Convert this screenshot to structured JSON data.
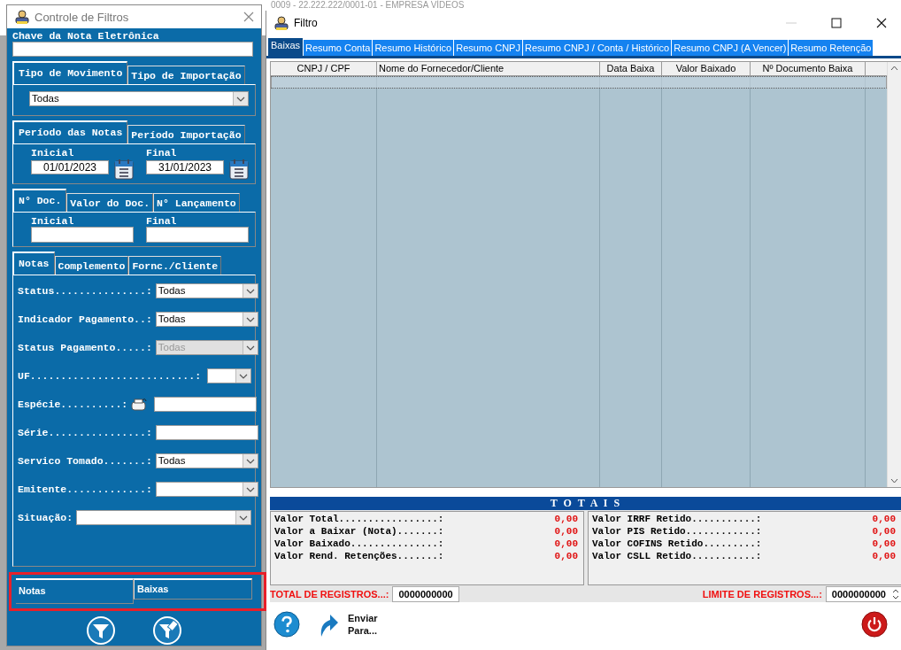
{
  "background_title": "0009 - 22.222.222/0001-01 - EMPRESA VÍDEOS",
  "filter_window": {
    "title": "Controle de Filtros",
    "key_field": {
      "label": "Chave da Nota Eletrônica"
    },
    "movement": {
      "tabs": [
        {
          "label": "Tipo de Movimento",
          "selected": true
        },
        {
          "label": "Tipo de Importação",
          "selected": false
        }
      ],
      "value": "Todas"
    },
    "period": {
      "tabs": [
        {
          "label": "Período das Notas",
          "selected": true
        },
        {
          "label": "Período Importação",
          "selected": false
        }
      ],
      "fields": [
        {
          "label": "Inicial",
          "value": "01/01/2023"
        },
        {
          "label": "Final",
          "value": "31/01/2023"
        }
      ]
    },
    "document": {
      "tabs": [
        {
          "label": "N° Doc.",
          "selected": true
        },
        {
          "label": "Valor do Doc.",
          "selected": false
        },
        {
          "label": "N° Lançamento",
          "selected": false
        }
      ],
      "fields": [
        {
          "label": "Inicial"
        },
        {
          "label": "Final"
        }
      ]
    },
    "details": {
      "tabs": [
        {
          "label": "Notas",
          "selected": true
        },
        {
          "label": "Complemento",
          "selected": false
        },
        {
          "label": "Fornc./Cliente",
          "selected": false
        }
      ],
      "rows": [
        {
          "label": "Status...............:",
          "kind": "select",
          "value": "Todas",
          "disabled": false
        },
        {
          "label": "Indicador Pagamento..:",
          "kind": "select",
          "value": "Todas",
          "disabled": false
        },
        {
          "label": "Status Pagamento.....:",
          "kind": "select",
          "value": "Todas",
          "disabled": true
        },
        {
          "label": "UF...........................:",
          "kind": "narrow-select",
          "disabled": false
        },
        {
          "label": "Espécie..........:",
          "kind": "lookup",
          "disabled": false
        },
        {
          "label": "Série................:",
          "kind": "text",
          "disabled": false
        },
        {
          "label": "Servico Tomado.......:",
          "kind": "select",
          "value": "Todas",
          "disabled": false
        },
        {
          "label": "Emitente.............:",
          "kind": "select",
          "disabled": false
        },
        {
          "label": "Situação:",
          "kind": "wide-select",
          "disabled": false
        }
      ]
    },
    "bottom_tabs": {
      "highlighted": true,
      "tabs": [
        {
          "label": "Notas",
          "selected": true
        },
        {
          "label": "Baixas",
          "selected": false
        }
      ]
    }
  },
  "results_window": {
    "title": "Filtro",
    "tabs": [
      {
        "label": "Baixas",
        "selected": true
      },
      {
        "label": "Resumo Conta",
        "selected": false
      },
      {
        "label": "Resumo Histórico",
        "selected": false
      },
      {
        "label": "Resumo CNPJ",
        "selected": false
      },
      {
        "label": "Resumo CNPJ / Conta / Histórico",
        "selected": false
      },
      {
        "label": "Resumo CNPJ (A Vencer)",
        "selected": false
      },
      {
        "label": "Resumo Retenção",
        "selected": false
      }
    ],
    "table": {
      "columns": [
        "CNPJ / CPF",
        "Nome do Fornecedor/Cliente",
        "Data Baixa",
        "Valor Baixado",
        "Nº Documento Baixa"
      ],
      "rows": [
        {
          "selected": true
        }
      ]
    },
    "totals": {
      "title": "T O T A I S",
      "left": [
        {
          "label": "Valor Total.................:",
          "value": "0,00"
        },
        {
          "label": "Valor a Baixar (Nota).......:",
          "value": "0,00"
        },
        {
          "label": "Valor Baixado...............:",
          "value": "0,00"
        },
        {
          "label": "Valor Rend. Retenções.......:",
          "value": "0,00"
        }
      ],
      "right": [
        {
          "label": "Valor IRRF Retido...........:",
          "value": "0,00"
        },
        {
          "label": "Valor PIS Retido............:",
          "value": "0,00"
        },
        {
          "label": "Valor COFINS Retido.........:",
          "value": "0,00"
        },
        {
          "label": "Valor CSLL Retido...........:",
          "value": "0,00"
        }
      ]
    },
    "record_count": {
      "label": "TOTAL DE REGISTROS...:",
      "value": "0000000000"
    },
    "record_limit": {
      "label": "LIMITE DE REGISTROS...:",
      "value": "0000000000"
    },
    "send_button": "Enviar Para..."
  }
}
